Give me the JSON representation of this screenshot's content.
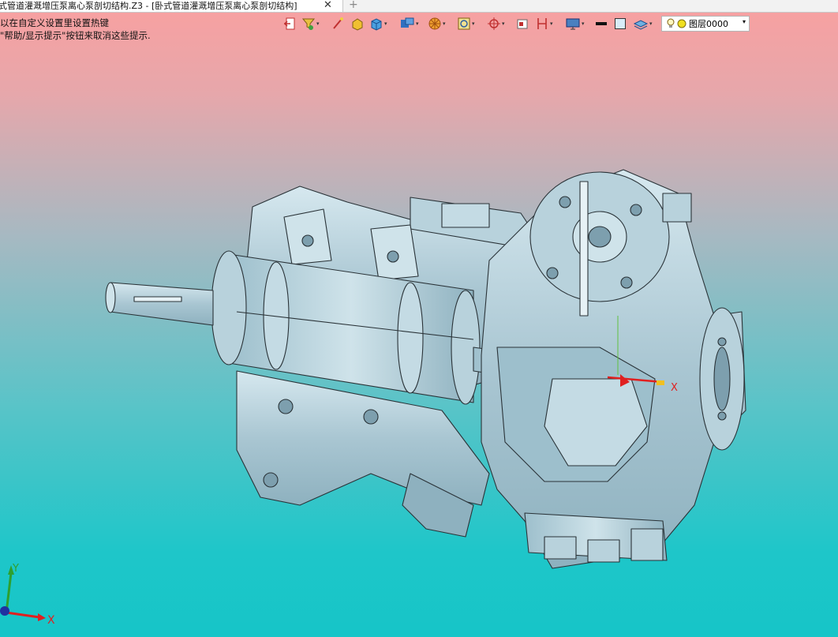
{
  "tab": {
    "title": "式管道灌溉增压泵离心泵剖切结构.Z3 - [卧式管道灌溉增压泵离心泵剖切结构]",
    "close_glyph": "✕",
    "new_tab_glyph": "+"
  },
  "hints": {
    "line1": "以在自定义设置里设置热键",
    "line2": "\"帮助/显示提示\"按钮来取消这些提示."
  },
  "toolbar": {
    "layer_label": "图层0000",
    "layer_dropdown_glyph": "▾",
    "dropdown_glyph": "▾"
  },
  "viewport": {
    "center_axis_label": "X",
    "triad_x_label": "X",
    "triad_y_label": "Y"
  },
  "colors": {
    "bg_top": "#f9a0a0",
    "bg_bottom": "#16c5c8",
    "model_fill": "#b8d2dc",
    "model_edge": "#333333",
    "axis_x": "#e02020",
    "axis_y": "#2ea02e"
  }
}
